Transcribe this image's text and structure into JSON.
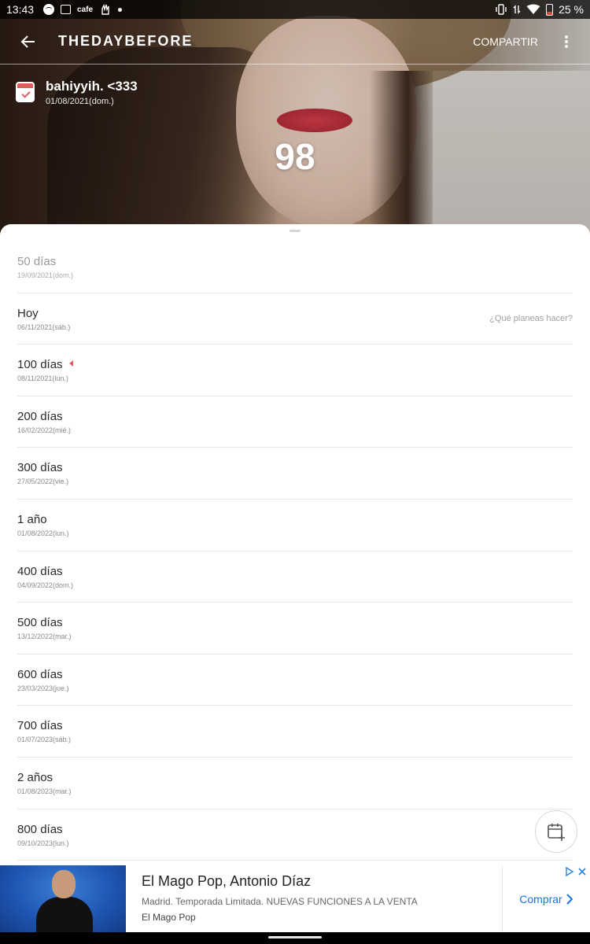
{
  "status_bar": {
    "time": "13:43",
    "app_icons": [
      "spotify-icon",
      "photo-icon",
      "cafe-icon",
      "hand-icon",
      "dot"
    ],
    "cafe_text": "cafe",
    "battery_text": "25 %"
  },
  "app_bar": {
    "logo": "THEDAYBEFORE",
    "share_label": "COMPARTIR"
  },
  "event": {
    "title": "bahiyyih. <333",
    "date": "01/08/2021(dom.)",
    "count": "98"
  },
  "milestones": [
    {
      "label": "50 días",
      "date": "19/09/2021(dom.)"
    },
    {
      "label": "Hoy",
      "date": "06/11/2021(sáb.)",
      "hint": "¿Qué planeas hacer?"
    },
    {
      "label": "100 días",
      "date": "08/11/2021(lun.)"
    },
    {
      "label": "200 días",
      "date": "16/02/2022(mié.)"
    },
    {
      "label": "300 días",
      "date": "27/05/2022(vie.)"
    },
    {
      "label": "1 año",
      "date": "01/08/2022(lun.)"
    },
    {
      "label": "400 días",
      "date": "04/09/2022(dom.)"
    },
    {
      "label": "500 días",
      "date": "13/12/2022(mar.)"
    },
    {
      "label": "600 días",
      "date": "23/03/2023(jue.)"
    },
    {
      "label": "700 días",
      "date": "01/07/2023(sáb.)"
    },
    {
      "label": "2 años",
      "date": "01/08/2023(mar.)"
    },
    {
      "label": "800 días",
      "date": "09/10/2023(lun.)"
    }
  ],
  "ad": {
    "title": "El Mago Pop, Antonio Díaz",
    "description": "Madrid. Temporada Limitada. NUEVAS FUNCIONES A LA VENTA",
    "advertiser": "El Mago Pop",
    "cta": "Comprar"
  },
  "colors": {
    "accent": "#e85a5a",
    "cta_blue": "#1a73e8"
  }
}
